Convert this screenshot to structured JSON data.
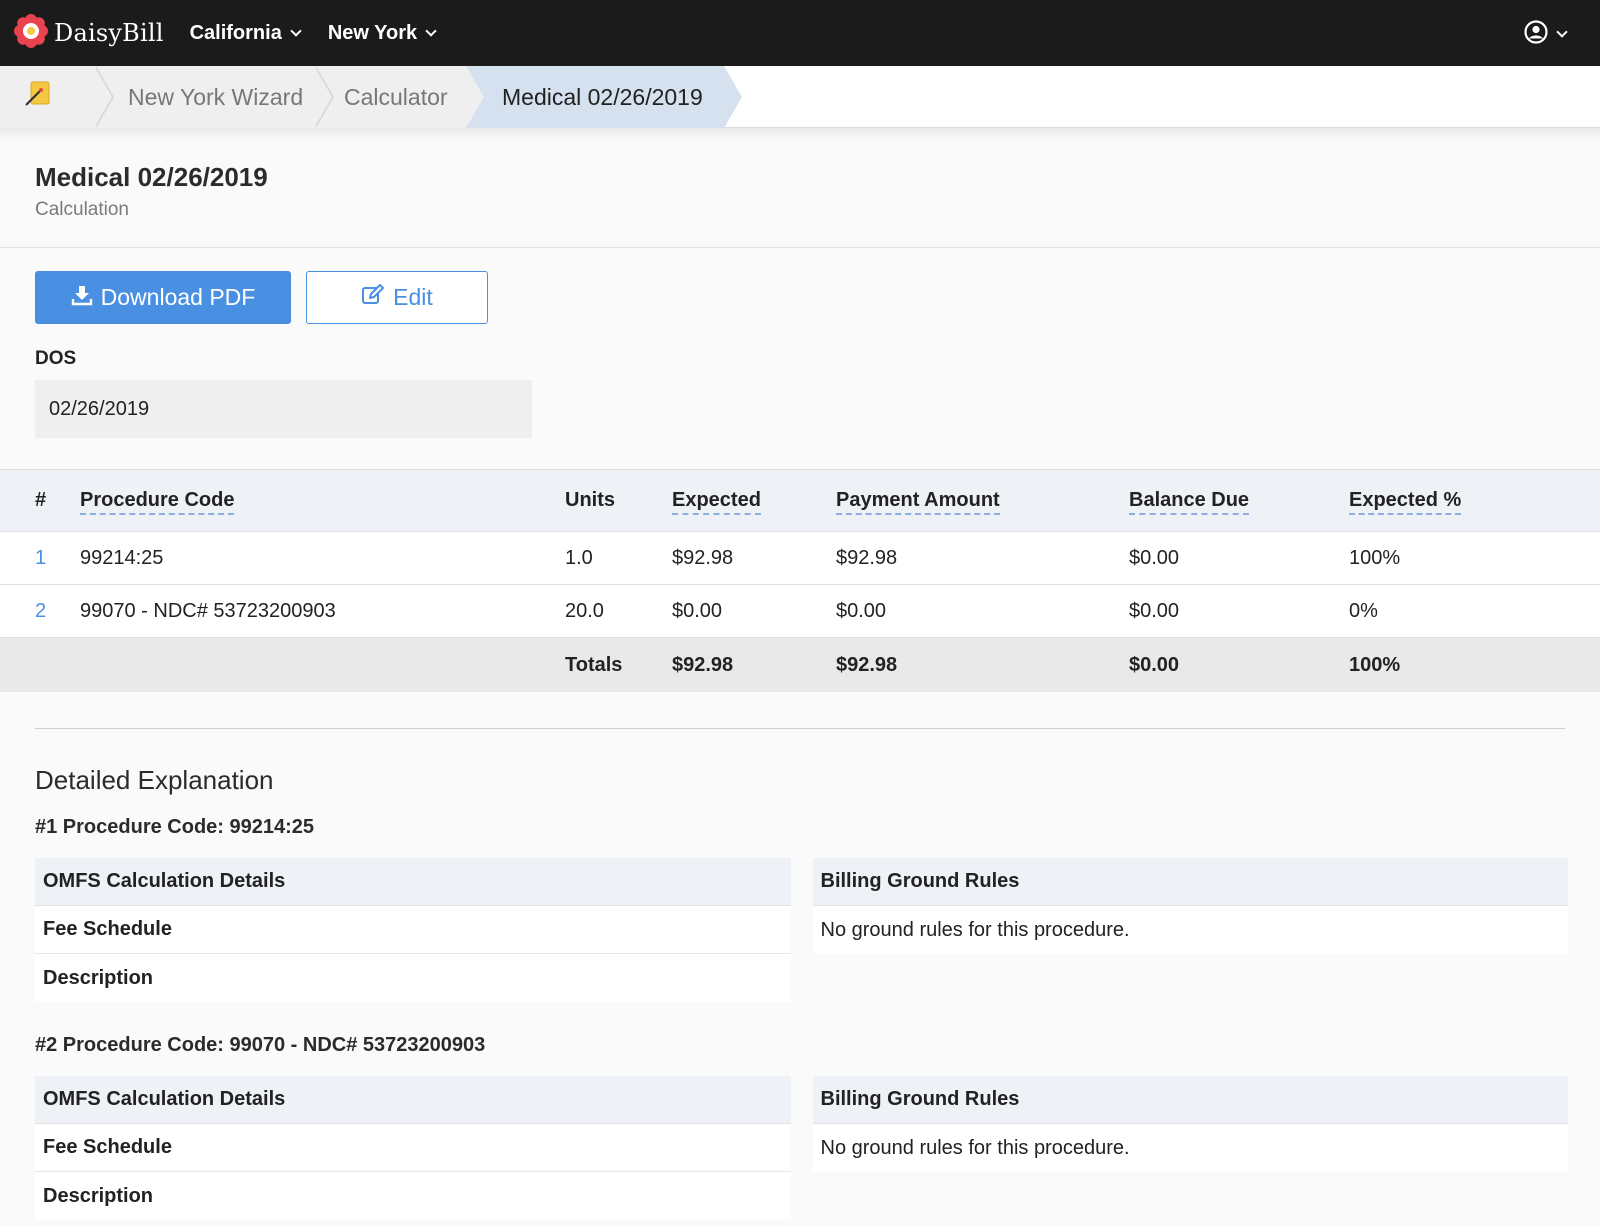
{
  "nav": {
    "brand": "DaisyBill",
    "menus": [
      {
        "label": "California"
      },
      {
        "label": "New York"
      }
    ]
  },
  "breadcrumb": {
    "items": [
      "New York Wizard",
      "Calculator",
      "Medical 02/26/2019"
    ]
  },
  "header": {
    "title": "Medical 02/26/2019",
    "subtitle": "Calculation"
  },
  "actions": {
    "download_label": "Download PDF",
    "edit_label": "Edit"
  },
  "dos": {
    "label": "DOS",
    "value": "02/26/2019"
  },
  "table": {
    "columns": [
      "#",
      "Procedure Code",
      "Units",
      "Expected",
      "Payment Amount",
      "Balance Due",
      "Expected %"
    ],
    "rows": [
      {
        "num": "1",
        "code": "99214:25",
        "units": "1.0",
        "expected": "$92.98",
        "payment": "$92.98",
        "balance": "$0.00",
        "pct": "100%"
      },
      {
        "num": "2",
        "code": "99070 - NDC# 53723200903",
        "units": "20.0",
        "expected": "$0.00",
        "payment": "$0.00",
        "balance": "$0.00",
        "pct": "0%"
      }
    ],
    "totals": {
      "label": "Totals",
      "expected": "$92.98",
      "payment": "$92.98",
      "balance": "$0.00",
      "pct": "100%"
    }
  },
  "explanation": {
    "title": "Detailed Explanation",
    "procedures": [
      {
        "heading": "#1 Procedure Code: 99214:25",
        "omfs_title": "OMFS Calculation Details",
        "fee_schedule": "Fee Schedule",
        "description": "Description",
        "rules_title": "Billing Ground Rules",
        "rules_text": "No ground rules for this procedure."
      },
      {
        "heading": "#2 Procedure Code: 99070 - NDC# 53723200903",
        "omfs_title": "OMFS Calculation Details",
        "fee_schedule": "Fee Schedule",
        "description": "Description",
        "rules_title": "Billing Ground Rules",
        "rules_text": "No ground rules for this procedure."
      }
    ]
  },
  "colors": {
    "nav_bg": "#1b1b1b",
    "accent": "#4a90e2",
    "breadcrumb_active": "#d5e1ef",
    "table_header": "#eef1f6"
  }
}
